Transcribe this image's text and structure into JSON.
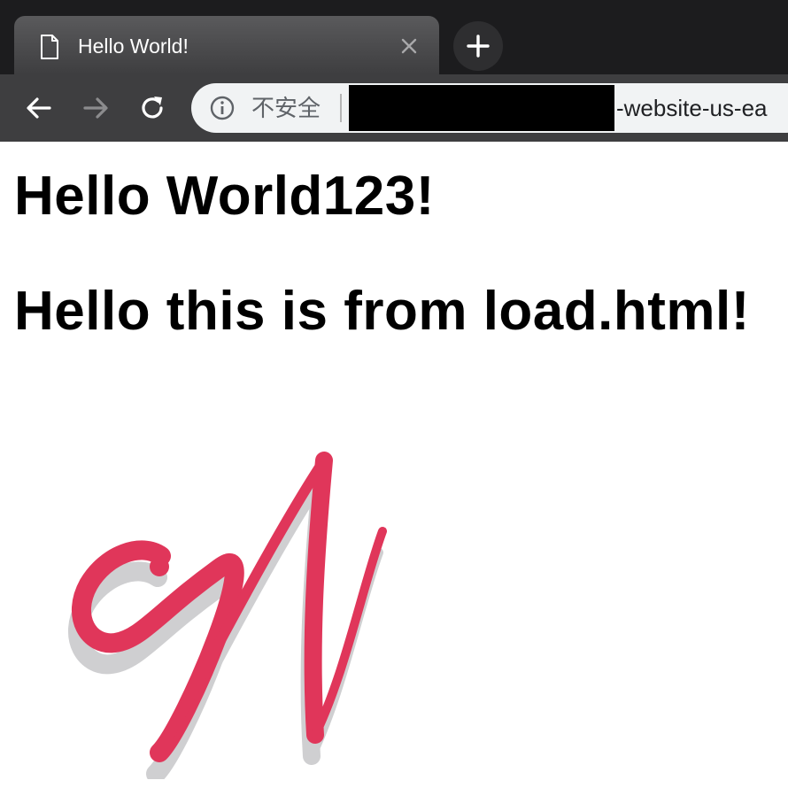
{
  "browser": {
    "tab": {
      "title": "Hello World!",
      "icon": "page-icon"
    },
    "new_tab_icon": "plus-icon",
    "toolbar": {
      "back_icon": "arrow-left-icon",
      "forward_icon": "arrow-right-icon",
      "reload_icon": "reload-icon",
      "address_bar": {
        "security_icon": "info-icon",
        "security_label": "不安全",
        "url_visible": "-website-us-ea"
      }
    }
  },
  "page": {
    "headings": [
      "Hello World123!",
      "Hello this is from load.html!"
    ],
    "logo": {
      "icon": "w-script-logo",
      "color": "#e0365a",
      "shadow_color": "#cfcfd1"
    }
  },
  "colors": {
    "tab_strip": "#1c1c1e",
    "toolbar": "#3e3e40",
    "omnibox": "#f1f3f4"
  }
}
